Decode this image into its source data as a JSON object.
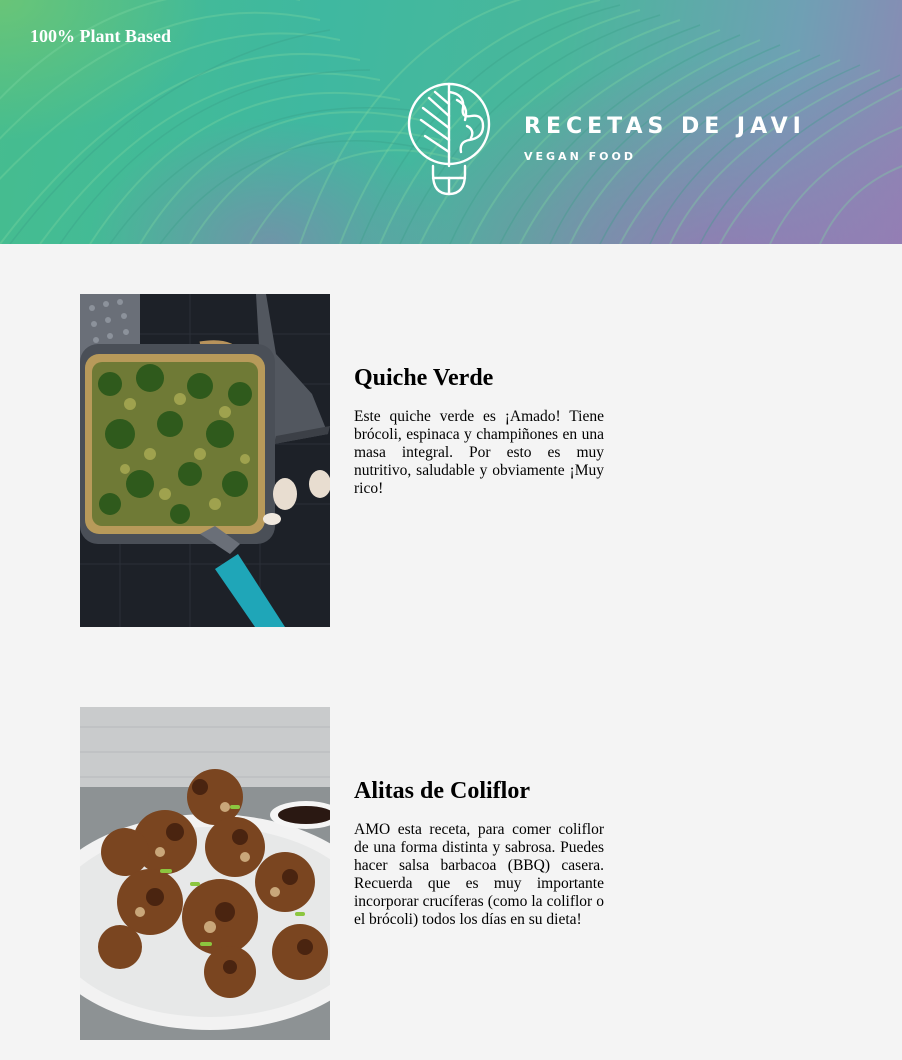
{
  "header": {
    "tagline": "100% Plant Based",
    "brand_title": "RECETAS DE JAVI",
    "brand_subtitle": "VEGAN FOOD",
    "logo_icon": "leaf-bowl-icon",
    "colors": {
      "green": "#46bd8e",
      "purple": "#8d87b4"
    }
  },
  "recipes": [
    {
      "title": "Quiche Verde",
      "description": "Este quiche verde es ¡Amado! Tiene brócoli, espinaca y champiñones en una masa integral. Por esto es muy nutritivo, saludable y obviamente ¡Muy rico!",
      "image": "quiche-photo"
    },
    {
      "title": "Alitas de Coliflor",
      "description": "AMO esta receta, para comer coliflor de una forma distinta y sabrosa. Puedes hacer salsa barbacoa (BBQ) casera. Recuerda que es muy importante incorporar crucíferas (como la coliflor o el brócoli) todos los días en su dieta!",
      "image": "cauliflower-wings-photo"
    }
  ],
  "colors": {
    "background": "#f4f4f4",
    "text": "#000000"
  }
}
